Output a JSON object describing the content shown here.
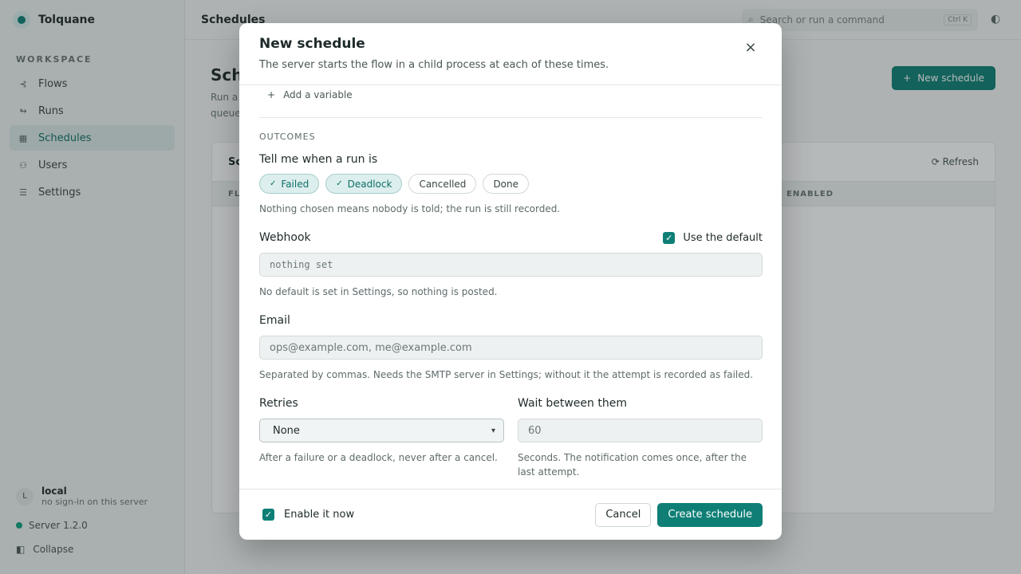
{
  "app": {
    "name": "Tolquane",
    "section_label": "WORKSPACE",
    "nav": [
      {
        "label": "Flows",
        "icon": "flows-icon"
      },
      {
        "label": "Runs",
        "icon": "runs-icon"
      },
      {
        "label": "Schedules",
        "icon": "calendar-icon",
        "active": true
      },
      {
        "label": "Users",
        "icon": "users-icon"
      },
      {
        "label": "Settings",
        "icon": "settings-icon"
      }
    ],
    "user": {
      "avatar": "L",
      "name": "local",
      "sub": "no sign-in on this server"
    },
    "server": "Server 1.2.0",
    "collapse": "Collapse"
  },
  "topbar": {
    "title": "Schedules",
    "search_placeholder": "Search or run a command",
    "shortcut": "Ctrl K"
  },
  "page": {
    "title": "Sch",
    "desc_line1": "Run a",
    "desc_line2": "queue",
    "new_button": "New schedule",
    "card_title": "Sc",
    "refresh": "Refresh",
    "col_first": "FL",
    "col_enabled": "ENABLED"
  },
  "modal": {
    "title": "New schedule",
    "subtitle": "The server starts the flow in a child process at each of these times.",
    "add_variable": "Add a variable",
    "outcomes_label": "OUTCOMES",
    "tell_me_label": "Tell me when a run is",
    "chips": [
      {
        "label": "Failed",
        "on": true
      },
      {
        "label": "Deadlock",
        "on": true
      },
      {
        "label": "Cancelled",
        "on": false
      },
      {
        "label": "Done",
        "on": false
      }
    ],
    "outcome_help": "Nothing chosen means nobody is told; the run is still recorded.",
    "webhook_label": "Webhook",
    "use_default_label": "Use the default",
    "webhook_value": "nothing set",
    "webhook_help": "No default is set in Settings, so nothing is posted.",
    "email_label": "Email",
    "email_placeholder": "ops@example.com, me@example.com",
    "email_help": "Separated by commas. Needs the SMTP server in Settings; without it the attempt is recorded as failed.",
    "retries_label": "Retries",
    "retries_value": "None",
    "retries_help": "After a failure or a deadlock, never after a cancel.",
    "wait_label": "Wait between them",
    "wait_value": "60",
    "wait_help": "Seconds. The notification comes once, after the last attempt.",
    "enable_label": "Enable it now",
    "cancel_button": "Cancel",
    "create_button": "Create schedule"
  }
}
